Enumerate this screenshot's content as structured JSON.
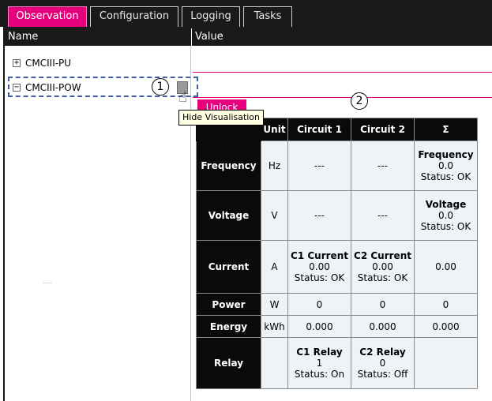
{
  "tabs": [
    {
      "label": "Observation",
      "active": true
    },
    {
      "label": "Configuration",
      "active": false
    },
    {
      "label": "Logging",
      "active": false
    },
    {
      "label": "Tasks",
      "active": false
    }
  ],
  "columns": {
    "name": "Name",
    "value": "Value"
  },
  "tree": [
    {
      "expander": "+",
      "label": "CMCIII-PU"
    },
    {
      "expander": "−",
      "label": "CMCIII-POW"
    }
  ],
  "callouts": {
    "one": "1",
    "two": "2"
  },
  "tooltip": "Hide Visualisation",
  "unlock_label": "Unlock",
  "table": {
    "headers": {
      "unit": "Unit",
      "circuit1": "Circuit 1",
      "circuit2": "Circuit 2",
      "sum": "Σ"
    },
    "rows": {
      "frequency": {
        "label": "Frequency",
        "unit": "Hz",
        "c1": "---",
        "c2": "---",
        "sum_title": "Frequency",
        "sum_value": "0.0",
        "sum_status": "Status: OK"
      },
      "voltage": {
        "label": "Voltage",
        "unit": "V",
        "c1": "---",
        "c2": "---",
        "sum_title": "Voltage",
        "sum_value": "0.0",
        "sum_status": "Status: OK"
      },
      "current": {
        "label": "Current",
        "unit": "A",
        "c1_title": "C1 Current",
        "c1_value": "0.00",
        "c1_status": "Status: OK",
        "c2_title": "C2 Current",
        "c2_value": "0.00",
        "c2_status": "Status: OK",
        "sum": "0.00"
      },
      "power": {
        "label": "Power",
        "unit": "W",
        "c1": "0",
        "c2": "0",
        "sum": "0"
      },
      "energy": {
        "label": "Energy",
        "unit": "kWh",
        "c1": "0.000",
        "c2": "0.000",
        "sum": "0.000"
      },
      "relay": {
        "label": "Relay",
        "unit": "",
        "c1_title": "C1 Relay",
        "c1_value": "1",
        "c1_status": "Status: On",
        "c2_title": "C2 Relay",
        "c2_value": "0",
        "c2_status": "Status: Off",
        "sum": ""
      }
    }
  },
  "colors": {
    "accent": "#e6007e",
    "selection": "#3c5fa6",
    "tooltip_bg": "#ffffe1",
    "header_bg": "#0a0a0a",
    "cell_bg": "#eef3f8"
  }
}
